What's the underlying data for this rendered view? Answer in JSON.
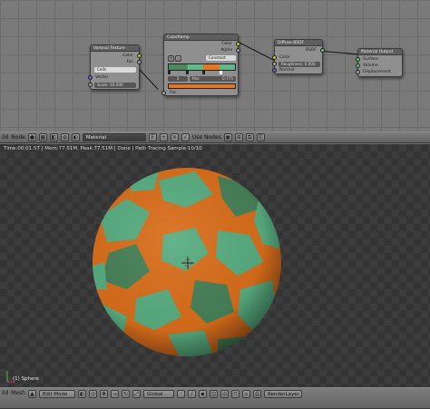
{
  "colors": {
    "sphere_orange": "#e8761e",
    "sphere_green": "#5fb98a",
    "sphere_darkgreen": "#4c8a5e",
    "background_checker_dark": "#343434",
    "background_checker_light": "#3c3c3c"
  },
  "nodes": {
    "voronoi": {
      "title": "Voronoi Texture",
      "out_color": "Color",
      "out_fac": "Fac",
      "coloring": "Cells",
      "in_vector": "Vector",
      "scale": "Scale: 10.000"
    },
    "colorramp": {
      "title": "ColorRamp",
      "out_color": "Color",
      "out_alpha": "Alpha",
      "mode": "Constant",
      "stop_index": "3",
      "pos": "Pos:",
      "pos_value": "0.775",
      "in_fac": "Fac"
    },
    "diffuse": {
      "title": "Diffuse BSDF",
      "out_bsdf": "BSDF",
      "in_color": "Color",
      "roughness": "Roughness: 0.000",
      "in_normal": "Normal"
    },
    "output": {
      "title": "Material Output",
      "surface": "Surface",
      "volume": "Volume",
      "displacement": "Displacement"
    }
  },
  "node_header": {
    "view_label": "ild",
    "node_menu": "Node",
    "material_name": "Material",
    "fake_user": "F",
    "use_nodes": "Use Nodes"
  },
  "viewport": {
    "render_stats": "Time:00:01.57 | Mem:77.51M, Peak:77.51M | Done | Path Tracing Sample 10/10",
    "object_label": "(1) Sphere"
  },
  "view3d_header": {
    "build_label": "ild",
    "mesh_menu": "Mesh",
    "mode": "Edit Mode",
    "orientation": "Global",
    "layer": "RenderLayer"
  }
}
